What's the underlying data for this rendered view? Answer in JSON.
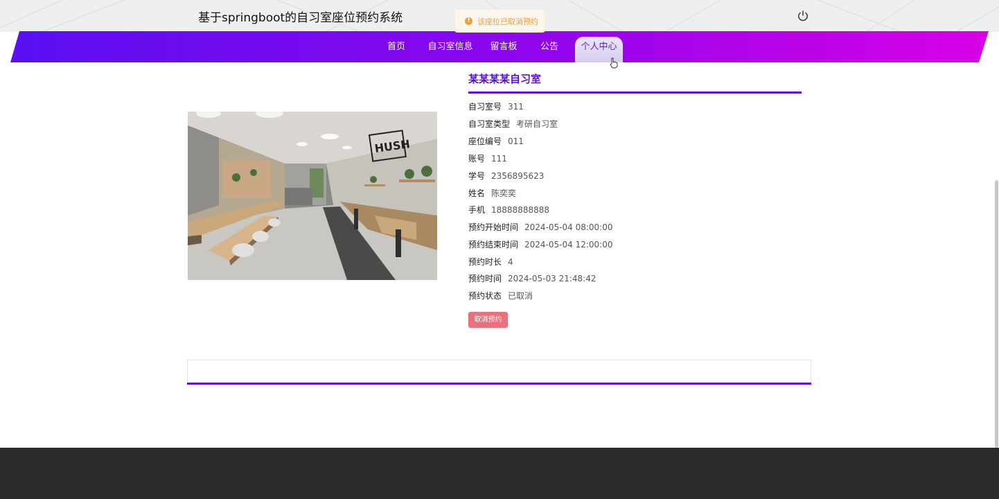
{
  "header": {
    "title": "基于springboot的自习室座位预约系统",
    "power_icon": "power-icon"
  },
  "toast": {
    "icon": "warning-icon",
    "text": "该座位已取消预约"
  },
  "nav": {
    "items": [
      {
        "label": "首页"
      },
      {
        "label": "自习室信息"
      },
      {
        "label": "留言板"
      },
      {
        "label": "公告"
      },
      {
        "label": "个人中心"
      }
    ],
    "active": "个人中心"
  },
  "room": {
    "title": "某某某某自习室",
    "image": "study-room-photo",
    "fields": [
      {
        "label": "自习室号",
        "value": "311"
      },
      {
        "label": "自习室类型",
        "value": "考研自习室"
      },
      {
        "label": "座位编号",
        "value": "011"
      },
      {
        "label": "账号",
        "value": "111"
      },
      {
        "label": "学号",
        "value": "2356895623"
      },
      {
        "label": "姓名",
        "value": "陈奕奕"
      },
      {
        "label": "手机",
        "value": "18888888888"
      },
      {
        "label": "预约开始时间",
        "value": "2024-05-04 08:00:00"
      },
      {
        "label": "预约结束时间",
        "value": "2024-05-04 12:00:00"
      },
      {
        "label": "预约时长",
        "value": "4"
      },
      {
        "label": "预约时间",
        "value": "2024-05-03 21:48:42"
      },
      {
        "label": "预约状态",
        "value": "已取消"
      }
    ],
    "cancel_label": "取消预约"
  },
  "colors": {
    "accent": "#6a0fd8",
    "nav_gradient_start": "#5b10f0",
    "nav_gradient_end": "#d400e8",
    "cancel_button": "#e8707f",
    "toast_text": "#e6a23c",
    "footer": "#2b2b2b"
  }
}
